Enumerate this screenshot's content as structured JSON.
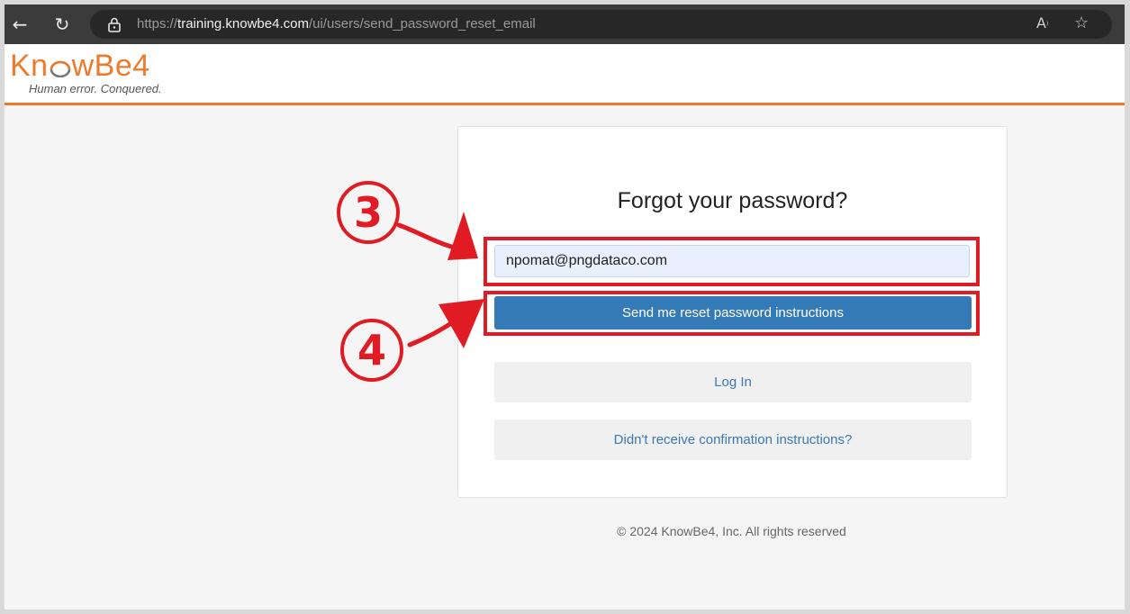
{
  "browser": {
    "url_scheme": "https://",
    "url_host": "training.knowbe4.com",
    "url_path": "/ui/users/send_password_reset_email"
  },
  "header": {
    "logo_part1": "Kn",
    "logo_part2": "wBe4",
    "tagline": "Human error. Conquered.",
    "accent_color": "#f0782a"
  },
  "form": {
    "title": "Forgot your password?",
    "email_value": "npomat@pngdataco.com",
    "reset_button": "Send me reset password instructions",
    "login_button": "Log In",
    "confirm_button": "Didn't receive confirmation instructions?"
  },
  "footer": {
    "copyright": "© 2024 KnowBe4, Inc. All rights reserved"
  },
  "annotations": {
    "step_email": "3",
    "step_button": "4",
    "color": "#e01b24"
  }
}
